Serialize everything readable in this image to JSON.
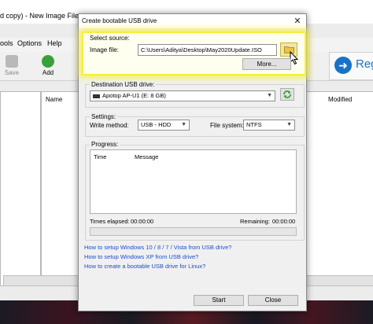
{
  "background_app": {
    "title": "d copy) - New Image File",
    "menu": [
      "ools",
      "Options",
      "Help"
    ],
    "toolbar": {
      "save_label": "Save",
      "add_label": "Add"
    },
    "register_label": "Reg",
    "columns": {
      "name": "Name",
      "modified": "Modified"
    }
  },
  "dialog": {
    "title": "Create bootable USB drive",
    "close_glyph": "✕",
    "source": {
      "group_label": "Select source:",
      "image_file_label": "Image file:",
      "image_path": "C:\\Users\\Aditya\\Desktop\\May2020Update.ISO",
      "more_button": "More..."
    },
    "destination": {
      "group_label": "Destination USB drive:",
      "drive": "Apotop AP-U1 (E:  8 GB)"
    },
    "settings": {
      "group_label": "Settings:",
      "write_method_label": "Write method:",
      "write_method": "USB - HDD",
      "file_system_label": "File system:",
      "file_system": "NTFS"
    },
    "progress": {
      "group_label": "Progress:",
      "col_time": "Time",
      "col_message": "Message",
      "elapsed_label": "Times elapsed:",
      "elapsed": "00:00:00",
      "remaining_label": "Remaining:",
      "remaining": "00:00:00",
      "percent": 0
    },
    "links": [
      "How to setup Windows 10 / 8 / 7 / Vista from USB drive?",
      "How to setup Windows XP from USB drive?",
      "How to create a bootable USB drive for Linux?"
    ],
    "start_button": "Start",
    "close_button": "Close"
  },
  "colors": {
    "highlight": "#f6ef3a",
    "link": "#1a4fc8",
    "accent": "#1a72c7"
  },
  "icons": [
    "folder-icon",
    "refresh-icon",
    "usb-drive-icon",
    "close-icon",
    "save-icon",
    "add-icon",
    "arrow-right-icon",
    "mouse-cursor-icon"
  ]
}
